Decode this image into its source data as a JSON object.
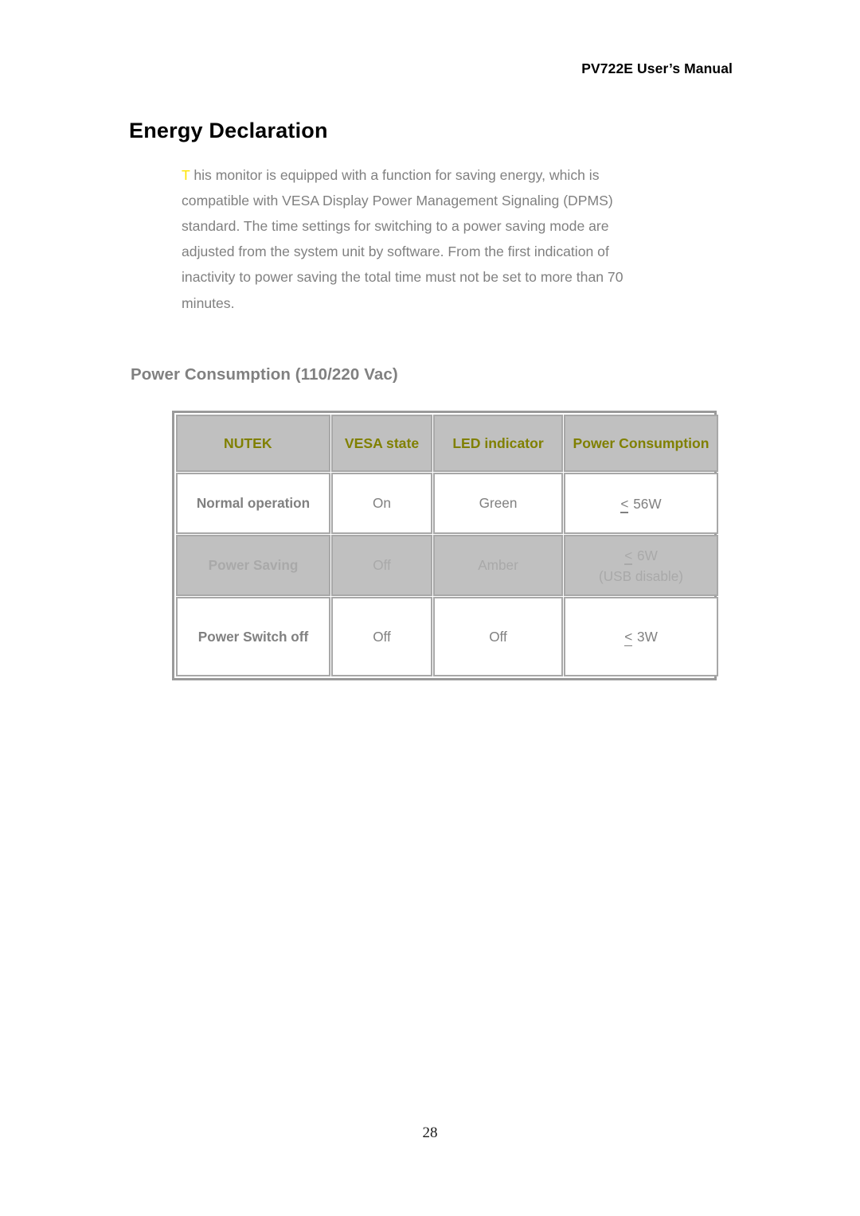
{
  "document": {
    "running_header": "PV722E User’s Manual",
    "title": "Energy Declaration",
    "intro_dropcap": "T",
    "intro_body": " his monitor is equipped with a function for saving energy, which is compatible with VESA Display Power Management Signaling (DPMS) standard. The time settings for switching to a power saving mode are adjusted from the system unit by software. From the first indication of inactivity to power saving the total time must not be set to more than 70 minutes.",
    "subtitle": "Power Consumption (110/220 Vac)",
    "page_number": "28"
  },
  "table": {
    "headers": {
      "c1": "NUTEK",
      "c2": "VESA state",
      "c3": "LED indicator",
      "c4": "Power Consumption"
    },
    "rows": [
      {
        "nutek": "Normal operation",
        "vesa_state": "On",
        "led_indicator": "Green",
        "power_op": "<",
        "power_value": " 56W",
        "power_note": ""
      },
      {
        "nutek": "Power Saving",
        "vesa_state": "Off",
        "led_indicator": "Amber",
        "power_op": "<",
        "power_value": " 6W",
        "power_note": "(USB disable)"
      },
      {
        "nutek": "Power Switch off",
        "vesa_state": "Off",
        "led_indicator": "Off",
        "power_op": "<",
        "power_value": " 3W",
        "power_note": ""
      }
    ]
  },
  "colors": {
    "header_text": "#808000",
    "body_text": "#808080",
    "dropcap": "#ffe400",
    "row_shaded_bg": "#c0c0c0",
    "row_shaded_text": "#a9a9a9",
    "border": "#a8a8a8"
  }
}
